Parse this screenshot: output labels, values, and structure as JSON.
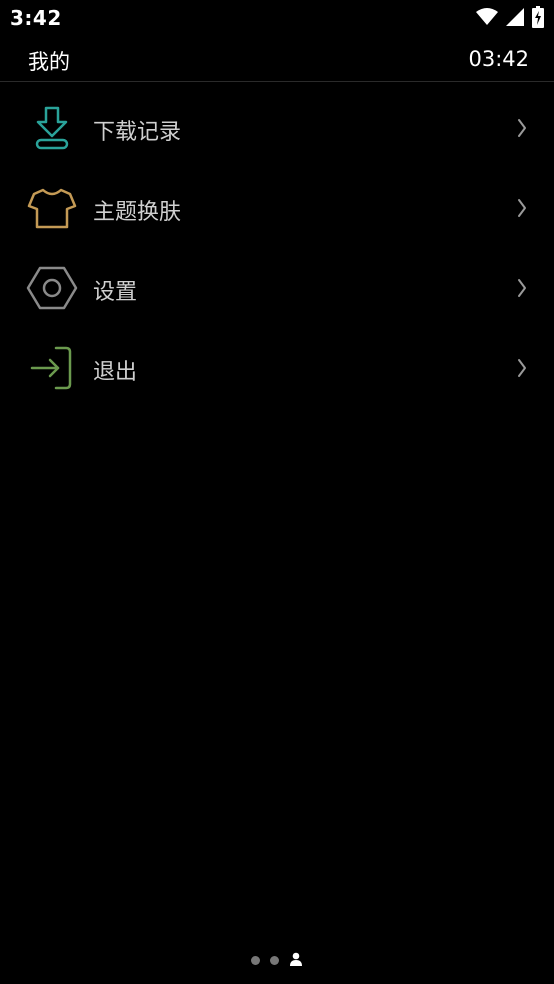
{
  "status_bar": {
    "time": "3:42",
    "icons": [
      "wifi-icon",
      "signal-icon",
      "battery-charging-icon"
    ]
  },
  "header": {
    "title": "我的",
    "clock": "03:42"
  },
  "menu": {
    "items": [
      {
        "label": "下载记录",
        "icon": "download-icon",
        "color": "#2aa39a"
      },
      {
        "label": "主题换肤",
        "icon": "shirt-icon",
        "color": "#c49a55"
      },
      {
        "label": "设置",
        "icon": "settings-hexagon-icon",
        "color": "#8a8a8a"
      },
      {
        "label": "退出",
        "icon": "logout-icon",
        "color": "#6b9a4e"
      }
    ]
  },
  "page_indicator": {
    "total": 3,
    "active": 3,
    "active_icon": "person-icon"
  },
  "colors": {
    "background": "#000000",
    "text": "#ffffff",
    "label": "#d0d0d0",
    "chevron": "#9a9a9a",
    "divider": "#2a2a2a"
  }
}
